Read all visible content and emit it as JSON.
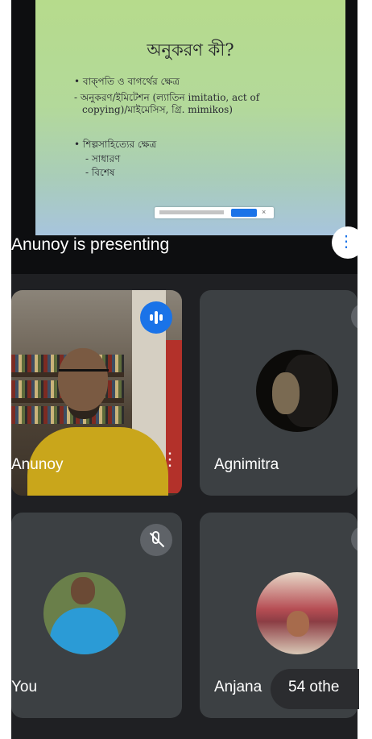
{
  "presentation": {
    "slide": {
      "title": "অনুকরণ কী?",
      "bullets": [
        "বাক্পতি ও বাগর্থের ক্ষেত্র",
        "অনুকরণ/ইমিটেশন (ল্যাতিন imitatio, act of",
        "copying)/মাইমেসিস, গ্রি. mimikos)",
        "শিল্পসাহিত্যের ক্ষেত্র",
        "সাধারণ",
        "বিশেষ"
      ]
    },
    "presenting_text": "Anunoy is presenting"
  },
  "participants": [
    {
      "name": "Anunoy",
      "speaking": true
    },
    {
      "name": "Agnimitra",
      "speaking": false
    },
    {
      "name": "You",
      "muted": true
    },
    {
      "name": "Anjana",
      "speaking": false
    }
  ],
  "others_count": "54 othe",
  "colors": {
    "accent": "#1a73e8",
    "tile_bg": "#3c4043",
    "screen_bg": "#1f2023"
  },
  "icons": [
    "audio-level-icon",
    "more-options-icon",
    "mic-off-icon"
  ]
}
